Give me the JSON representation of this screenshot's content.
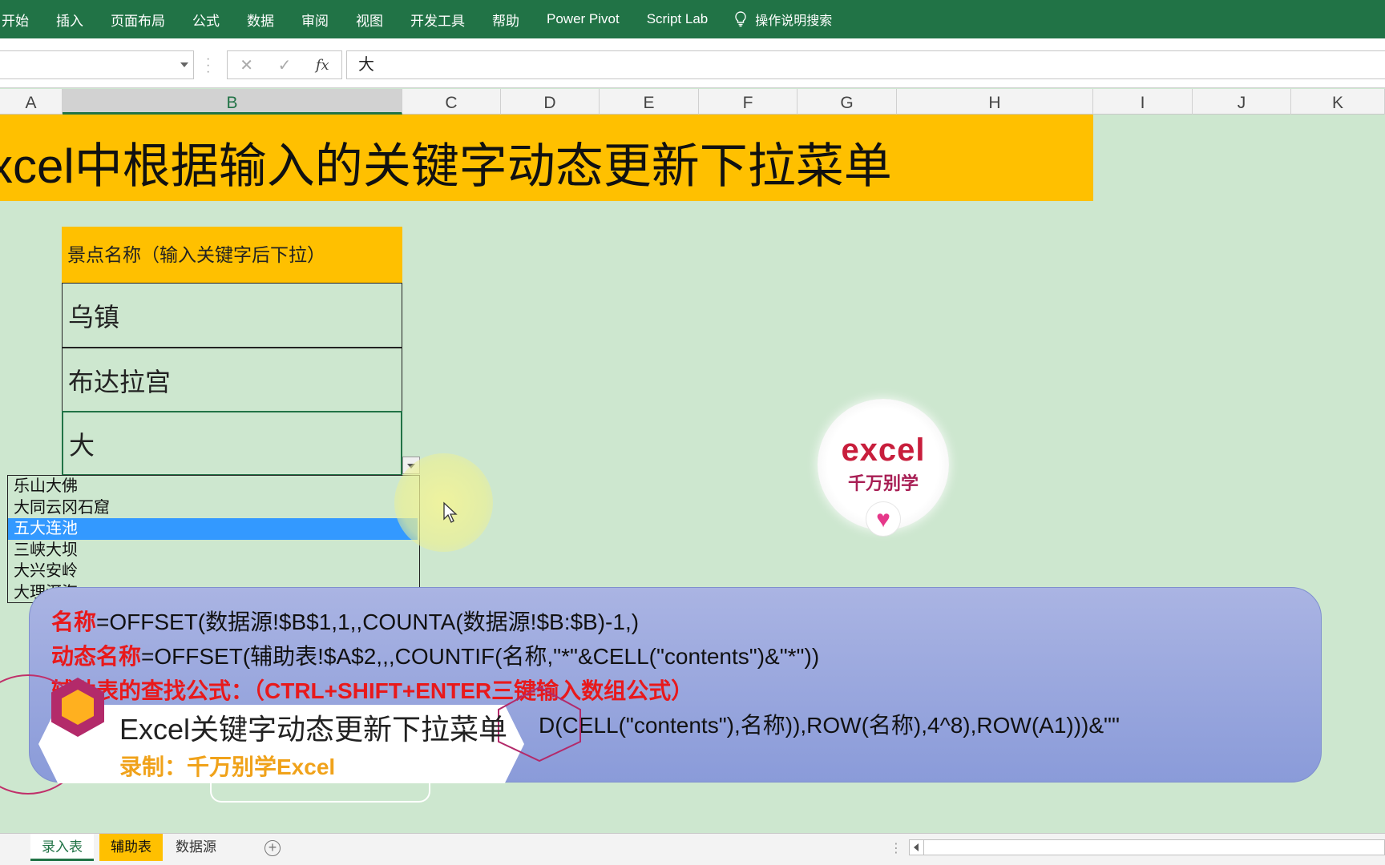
{
  "ribbon": {
    "tabs": [
      "开始",
      "插入",
      "页面布局",
      "公式",
      "数据",
      "审阅",
      "视图",
      "开发工具",
      "帮助",
      "Power Pivot",
      "Script Lab"
    ],
    "search_label": "操作说明搜索"
  },
  "formula_bar": {
    "name_box": "",
    "fx": "fx",
    "content": "大"
  },
  "columns": [
    "A",
    "B",
    "C",
    "D",
    "E",
    "F",
    "G",
    "H",
    "I",
    "J",
    "K"
  ],
  "sheet": {
    "title": "xcel中根据输入的关键字动态更新下拉菜单",
    "header": "景点名称（输入关键字后下拉）",
    "cells": [
      "乌镇",
      "布达拉宫",
      "大"
    ]
  },
  "dropdown": {
    "options": [
      "乐山大佛",
      "大同云冈石窟",
      "五大连池",
      "三峡大坝",
      "大兴安岭",
      "大理洱海"
    ],
    "selected_index": 2
  },
  "formulas": {
    "line1_label": "名称",
    "line1_formula": "=OFFSET(数据源!$B$1,1,,COUNTA(数据源!$B:$B)-1,)",
    "line2_label": "动态名称",
    "line2_formula": "=OFFSET(辅助表!$A$2,,,COUNTIF(名称,\"*\"&CELL(\"contents\")&\"*\"))",
    "line3_label": "辅助表的查找公式：（CTRL+SHIFT+ENTER三键输入数组公式）",
    "line4_formula": "D(CELL(\"contents\"),名称)),ROW(名称),4^8),ROW(A1)))&\"\""
  },
  "badge": {
    "line1": "excel",
    "line2": "千万别学",
    "icon": "heart-icon"
  },
  "overlay": {
    "title": "Excel关键字动态更新下拉菜单",
    "subtitle": "录制：千万别学Excel"
  },
  "sheet_tabs": [
    {
      "label": "录入表",
      "active": true
    },
    {
      "label": "辅助表",
      "highlight": "#ffc000"
    },
    {
      "label": "数据源"
    }
  ],
  "colors": {
    "ribbon": "#217346",
    "title_fill": "#ffc000",
    "sheet_bg": "#cde7cf",
    "selected_option": "#3399ff",
    "formula_label": "#e8191b"
  }
}
